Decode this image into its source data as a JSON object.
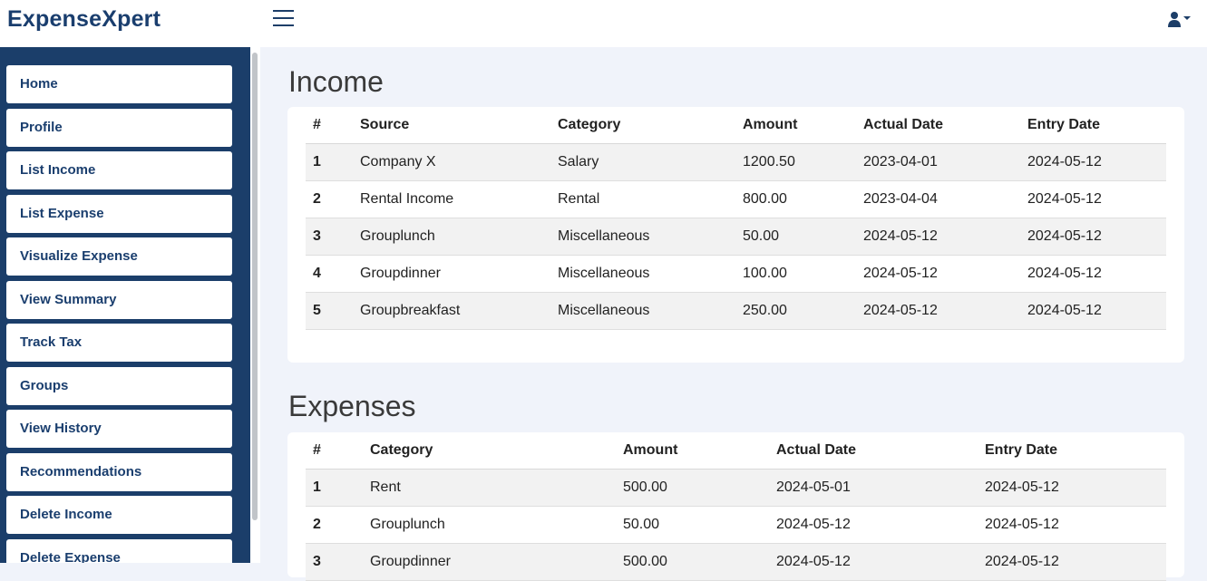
{
  "app": {
    "title": "ExpenseXpert"
  },
  "icons": {
    "menu": "hamburger-icon",
    "user": "user-icon",
    "caret": "caret-down-icon"
  },
  "sidebar": {
    "items": [
      {
        "label": "Home"
      },
      {
        "label": "Profile"
      },
      {
        "label": "List Income"
      },
      {
        "label": "List Expense"
      },
      {
        "label": "Visualize Expense"
      },
      {
        "label": "View Summary"
      },
      {
        "label": "Track Tax"
      },
      {
        "label": "Groups"
      },
      {
        "label": "View History"
      },
      {
        "label": "Recommendations"
      },
      {
        "label": "Delete Income"
      },
      {
        "label": "Delete Expense"
      }
    ]
  },
  "income": {
    "title": "Income",
    "headers": [
      "#",
      "Source",
      "Category",
      "Amount",
      "Actual Date",
      "Entry Date"
    ],
    "rows": [
      [
        "1",
        "Company X",
        "Salary",
        "1200.50",
        "2023-04-01",
        "2024-05-12"
      ],
      [
        "2",
        "Rental Income",
        "Rental",
        "800.00",
        "2023-04-04",
        "2024-05-12"
      ],
      [
        "3",
        "Grouplunch",
        "Miscellaneous",
        "50.00",
        "2024-05-12",
        "2024-05-12"
      ],
      [
        "4",
        "Groupdinner",
        "Miscellaneous",
        "100.00",
        "2024-05-12",
        "2024-05-12"
      ],
      [
        "5",
        "Groupbreakfast",
        "Miscellaneous",
        "250.00",
        "2024-05-12",
        "2024-05-12"
      ]
    ]
  },
  "expenses": {
    "title": "Expenses",
    "headers": [
      "#",
      "Category",
      "Amount",
      "Actual Date",
      "Entry Date"
    ],
    "rows": [
      [
        "1",
        "Rent",
        "500.00",
        "2024-05-01",
        "2024-05-12"
      ],
      [
        "2",
        "Grouplunch",
        "50.00",
        "2024-05-12",
        "2024-05-12"
      ],
      [
        "3",
        "Groupdinner",
        "500.00",
        "2024-05-12",
        "2024-05-12"
      ]
    ]
  },
  "colors": {
    "brand": "#1a3e6e",
    "sidebar_bg": "#1b3e6a",
    "page_bg": "#f0f3fa"
  }
}
